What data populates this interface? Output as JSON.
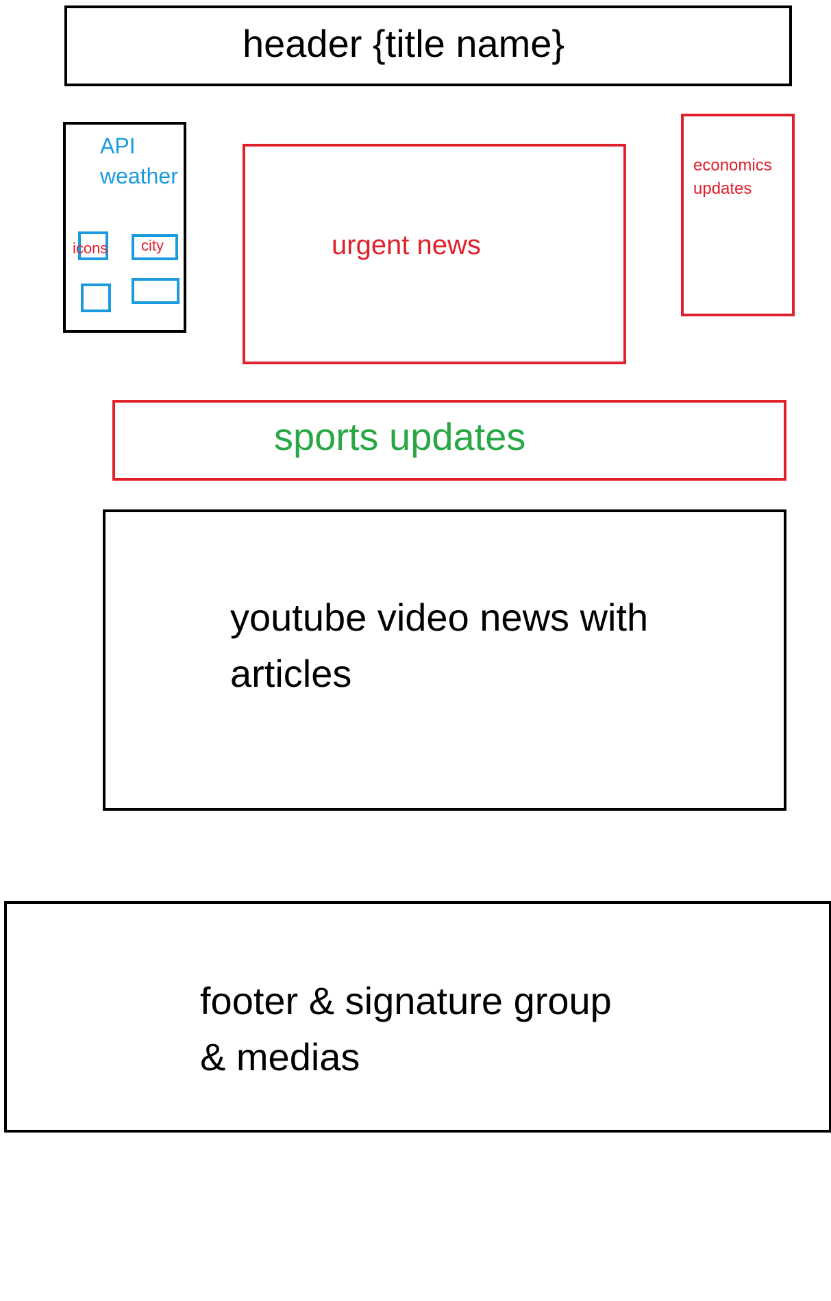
{
  "colors": {
    "outline_black": "#000000",
    "outline_red": "#e0202a",
    "outline_blue": "#1a9ae0",
    "text_black": "#000000",
    "text_red": "#e0202a",
    "text_blue": "#1a9ae0",
    "text_green": "#28a745"
  },
  "header": {
    "label": "header {title name}"
  },
  "weather": {
    "line1": "API",
    "line2": "weather",
    "icons_label": "icons",
    "city_label": "city"
  },
  "urgent_news": {
    "label": "urgent news"
  },
  "economics": {
    "line1": "economics",
    "line2": "updates"
  },
  "sports": {
    "label": "sports updates"
  },
  "youtube": {
    "line1": "youtube video news with",
    "line2": "articles"
  },
  "footer": {
    "line1": "footer & signature group",
    "line2": "& medias"
  }
}
